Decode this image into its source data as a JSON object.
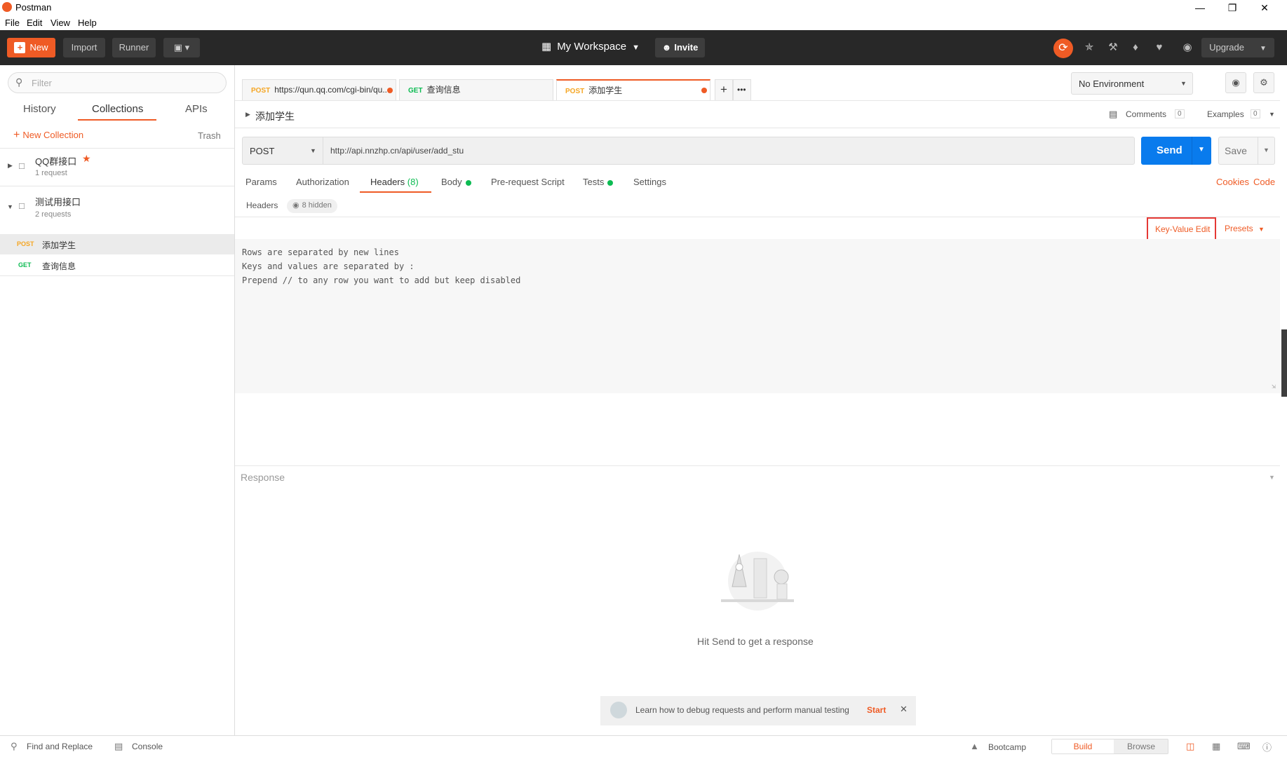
{
  "window": {
    "title": "Postman",
    "menu": [
      "File",
      "Edit",
      "View",
      "Help"
    ]
  },
  "toolbar": {
    "new_label": "New",
    "import_label": "Import",
    "runner_label": "Runner",
    "workspace_label": "My Workspace",
    "invite_label": "Invite",
    "upgrade_label": "Upgrade"
  },
  "sidebar": {
    "filter_placeholder": "Filter",
    "tabs": [
      "History",
      "Collections",
      "APIs"
    ],
    "active_tab": "Collections",
    "new_collection_label": "New Collection",
    "trash_label": "Trash",
    "collections": [
      {
        "name": "QQ群接口",
        "count": "1 request",
        "starred": true,
        "expanded": false
      },
      {
        "name": "测试用接口",
        "count": "2 requests",
        "starred": false,
        "expanded": true,
        "requests": [
          {
            "method": "POST",
            "name": "添加学生",
            "selected": true
          },
          {
            "method": "GET",
            "name": "查询信息",
            "selected": false
          }
        ]
      }
    ]
  },
  "request_tabs": [
    {
      "method": "POST",
      "label": "https://qun.qq.com/cgi-bin/qu...",
      "unsaved": true
    },
    {
      "method": "GET",
      "label": "查询信息",
      "unsaved": false
    },
    {
      "method": "POST",
      "label": "添加学生",
      "unsaved": true,
      "active": true
    }
  ],
  "environment": {
    "selected": "No Environment"
  },
  "request": {
    "name": "添加学生",
    "comments_label": "Comments",
    "comments_count": "0",
    "examples_label": "Examples",
    "examples_count": "0",
    "method": "POST",
    "url": "http://api.nnzhp.cn/api/user/add_stu",
    "send_label": "Send",
    "save_label": "Save",
    "subtabs": [
      "Params",
      "Authorization",
      "Headers",
      "Body",
      "Pre-request Script",
      "Tests",
      "Settings"
    ],
    "headers_count": "(8)",
    "cookies_label": "Cookies",
    "code_label": "Code",
    "headers_section_label": "Headers",
    "hidden_label": "8 hidden",
    "key_value_edit_label": "Key-Value Edit",
    "presets_label": "Presets",
    "bulk_hint_lines": [
      "Rows are separated by new lines",
      "Keys and values are separated by :",
      "Prepend // to any row you want to add but keep disabled"
    ]
  },
  "response": {
    "label": "Response",
    "empty_message": "Hit Send to get a response",
    "tip_text": "Learn how to debug requests and perform manual testing",
    "tip_start": "Start"
  },
  "statusbar": {
    "find_replace": "Find and Replace",
    "console": "Console",
    "bootcamp": "Bootcamp",
    "build": "Build",
    "browse": "Browse"
  },
  "colors": {
    "accent": "#ef5b25",
    "send_blue": "#097bed",
    "toolbar_bg": "#282828",
    "get_green": "#0cbb52",
    "post_orange": "#f5a623"
  }
}
